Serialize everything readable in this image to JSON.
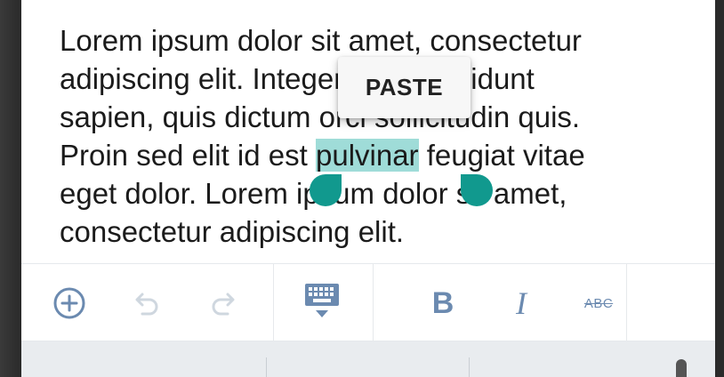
{
  "editor": {
    "lines": [
      {
        "before": "Lorem ipsum dolor sit amet, consectetur",
        "selected": "",
        "after": ""
      },
      {
        "before": "adipiscing elit. Integer dolor tincidunt",
        "selected": "",
        "after": ""
      },
      {
        "before": "sapien, quis dictum orci sollicitudin quis.",
        "selected": "",
        "after": ""
      },
      {
        "before": "Proin sed elit id est ",
        "selected": "pulvinar",
        "after": " feugiat vitae"
      },
      {
        "before": "eget dolor. Lorem ipsum dolor sit amet,",
        "selected": "",
        "after": ""
      },
      {
        "before": "consectetur adipiscing elit.",
        "selected": "",
        "after": ""
      }
    ]
  },
  "context_menu": {
    "paste_label": "PASTE"
  },
  "toolbar": {
    "icons": {
      "add": "add-circle-icon",
      "undo": "undo-icon",
      "redo": "redo-icon",
      "keyboard": "keyboard-hide-icon"
    },
    "bold_label": "B",
    "italic_label": "I",
    "strikethrough_label": "ABC"
  },
  "colors": {
    "selection": "#9fdcd8",
    "handle": "#11998e",
    "toolbar_icon": "#6b8ab0",
    "toolbar_icon_disabled": "#cfd7df"
  }
}
